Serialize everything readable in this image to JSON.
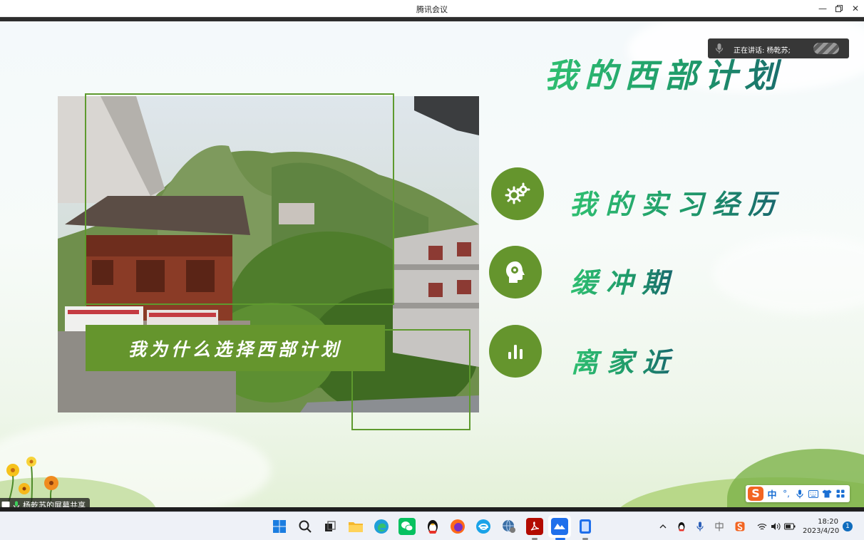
{
  "window": {
    "title": "腾讯会议"
  },
  "slide": {
    "title": "我的西部计划",
    "photo_caption": "我为什么选择西部计划",
    "items": [
      {
        "label": "我的实习经历",
        "icon": "gears-icon"
      },
      {
        "label": "缓冲期",
        "icon": "head-gear-icon"
      },
      {
        "label": "离家近",
        "icon": "bar-chart-icon"
      }
    ],
    "accent_color": "#65952d"
  },
  "speaking": {
    "label": "正在讲话: 杨乾苏;"
  },
  "share": {
    "label": "杨乾苏的屏幕共享"
  },
  "ime": {
    "mode": "中",
    "punct": "°,"
  },
  "taskbar": {
    "time": "18:20",
    "date": "2023/4/20",
    "notification_count": "1"
  }
}
